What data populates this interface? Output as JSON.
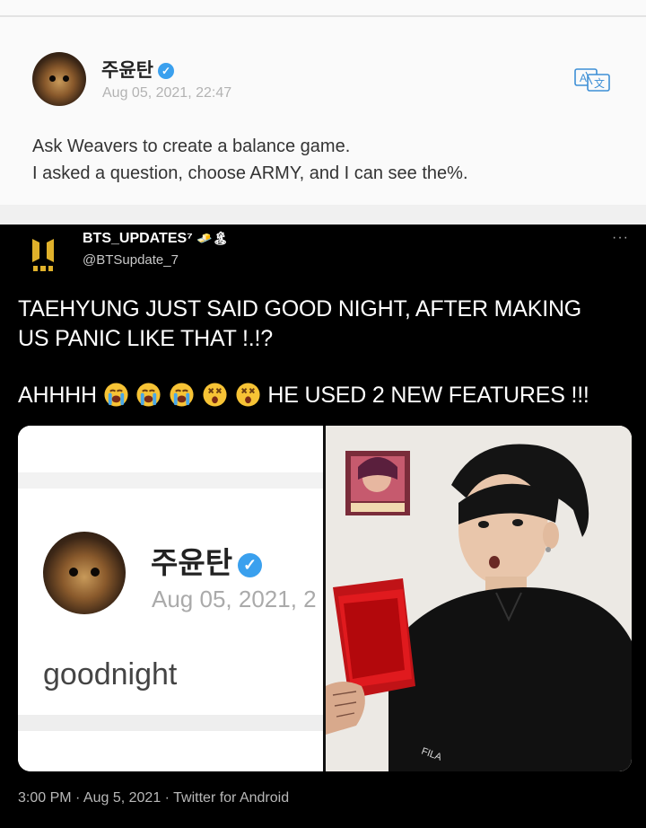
{
  "weverse_post": {
    "author": "주윤탄",
    "timestamp": "Aug 05, 2021, 22:47",
    "text_line1": "Ask Weavers to create a balance game.",
    "text_line2": "I asked a question, choose ARMY, and I can see the%.",
    "translate_icon": "translate-icon",
    "accent_color": "#3aa0ee"
  },
  "tweet": {
    "display_name": "BTS_UPDATES⁷",
    "name_emojis": "🧈🏝",
    "handle": "@BTSupdate_7",
    "more_icon": "···",
    "line1": "TAEHYUNG JUST SAID GOOD NIGHT, AFTER MAKING",
    "line2": "US PANIC LIKE THAT !.!?",
    "line3_start": "AHHHH",
    "line3_end": "HE USED 2 NEW FEATURES !!!",
    "emojis": [
      "loudly-crying-face",
      "loudly-crying-face",
      "loudly-crying-face",
      "dizzy-face",
      "dizzy-face"
    ],
    "meta": "3:00 PM · Aug 5, 2021 · Twitter for Android"
  },
  "embedded_screenshot": {
    "author": "주윤탄",
    "timestamp": "Aug 05, 2021, 2",
    "text": "goodnight"
  },
  "photo": {
    "poster_text": "",
    "shirt_logo": "FILA"
  }
}
